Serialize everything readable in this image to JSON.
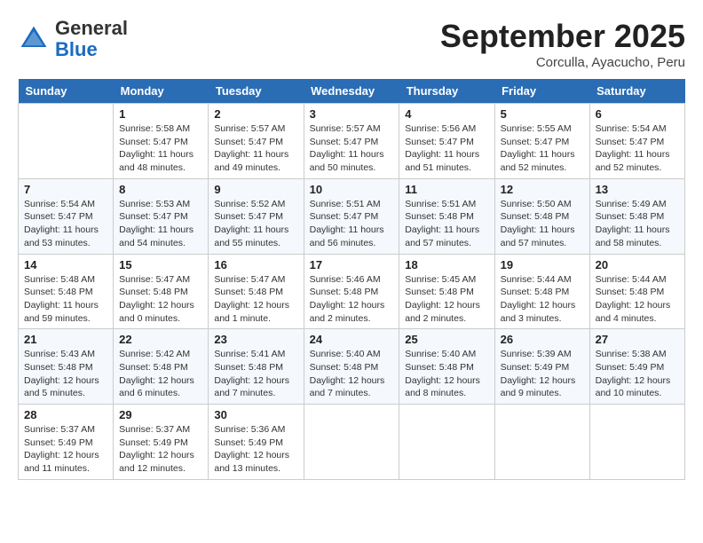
{
  "header": {
    "logo_general": "General",
    "logo_blue": "Blue",
    "month_title": "September 2025",
    "location": "Corculla, Ayacucho, Peru"
  },
  "columns": [
    "Sunday",
    "Monday",
    "Tuesday",
    "Wednesday",
    "Thursday",
    "Friday",
    "Saturday"
  ],
  "weeks": [
    [
      {
        "num": "",
        "info": ""
      },
      {
        "num": "1",
        "info": "Sunrise: 5:58 AM\nSunset: 5:47 PM\nDaylight: 11 hours\nand 48 minutes."
      },
      {
        "num": "2",
        "info": "Sunrise: 5:57 AM\nSunset: 5:47 PM\nDaylight: 11 hours\nand 49 minutes."
      },
      {
        "num": "3",
        "info": "Sunrise: 5:57 AM\nSunset: 5:47 PM\nDaylight: 11 hours\nand 50 minutes."
      },
      {
        "num": "4",
        "info": "Sunrise: 5:56 AM\nSunset: 5:47 PM\nDaylight: 11 hours\nand 51 minutes."
      },
      {
        "num": "5",
        "info": "Sunrise: 5:55 AM\nSunset: 5:47 PM\nDaylight: 11 hours\nand 52 minutes."
      },
      {
        "num": "6",
        "info": "Sunrise: 5:54 AM\nSunset: 5:47 PM\nDaylight: 11 hours\nand 52 minutes."
      }
    ],
    [
      {
        "num": "7",
        "info": "Sunrise: 5:54 AM\nSunset: 5:47 PM\nDaylight: 11 hours\nand 53 minutes."
      },
      {
        "num": "8",
        "info": "Sunrise: 5:53 AM\nSunset: 5:47 PM\nDaylight: 11 hours\nand 54 minutes."
      },
      {
        "num": "9",
        "info": "Sunrise: 5:52 AM\nSunset: 5:47 PM\nDaylight: 11 hours\nand 55 minutes."
      },
      {
        "num": "10",
        "info": "Sunrise: 5:51 AM\nSunset: 5:47 PM\nDaylight: 11 hours\nand 56 minutes."
      },
      {
        "num": "11",
        "info": "Sunrise: 5:51 AM\nSunset: 5:48 PM\nDaylight: 11 hours\nand 57 minutes."
      },
      {
        "num": "12",
        "info": "Sunrise: 5:50 AM\nSunset: 5:48 PM\nDaylight: 11 hours\nand 57 minutes."
      },
      {
        "num": "13",
        "info": "Sunrise: 5:49 AM\nSunset: 5:48 PM\nDaylight: 11 hours\nand 58 minutes."
      }
    ],
    [
      {
        "num": "14",
        "info": "Sunrise: 5:48 AM\nSunset: 5:48 PM\nDaylight: 11 hours\nand 59 minutes."
      },
      {
        "num": "15",
        "info": "Sunrise: 5:47 AM\nSunset: 5:48 PM\nDaylight: 12 hours\nand 0 minutes."
      },
      {
        "num": "16",
        "info": "Sunrise: 5:47 AM\nSunset: 5:48 PM\nDaylight: 12 hours\nand 1 minute."
      },
      {
        "num": "17",
        "info": "Sunrise: 5:46 AM\nSunset: 5:48 PM\nDaylight: 12 hours\nand 2 minutes."
      },
      {
        "num": "18",
        "info": "Sunrise: 5:45 AM\nSunset: 5:48 PM\nDaylight: 12 hours\nand 2 minutes."
      },
      {
        "num": "19",
        "info": "Sunrise: 5:44 AM\nSunset: 5:48 PM\nDaylight: 12 hours\nand 3 minutes."
      },
      {
        "num": "20",
        "info": "Sunrise: 5:44 AM\nSunset: 5:48 PM\nDaylight: 12 hours\nand 4 minutes."
      }
    ],
    [
      {
        "num": "21",
        "info": "Sunrise: 5:43 AM\nSunset: 5:48 PM\nDaylight: 12 hours\nand 5 minutes."
      },
      {
        "num": "22",
        "info": "Sunrise: 5:42 AM\nSunset: 5:48 PM\nDaylight: 12 hours\nand 6 minutes."
      },
      {
        "num": "23",
        "info": "Sunrise: 5:41 AM\nSunset: 5:48 PM\nDaylight: 12 hours\nand 7 minutes."
      },
      {
        "num": "24",
        "info": "Sunrise: 5:40 AM\nSunset: 5:48 PM\nDaylight: 12 hours\nand 7 minutes."
      },
      {
        "num": "25",
        "info": "Sunrise: 5:40 AM\nSunset: 5:48 PM\nDaylight: 12 hours\nand 8 minutes."
      },
      {
        "num": "26",
        "info": "Sunrise: 5:39 AM\nSunset: 5:49 PM\nDaylight: 12 hours\nand 9 minutes."
      },
      {
        "num": "27",
        "info": "Sunrise: 5:38 AM\nSunset: 5:49 PM\nDaylight: 12 hours\nand 10 minutes."
      }
    ],
    [
      {
        "num": "28",
        "info": "Sunrise: 5:37 AM\nSunset: 5:49 PM\nDaylight: 12 hours\nand 11 minutes."
      },
      {
        "num": "29",
        "info": "Sunrise: 5:37 AM\nSunset: 5:49 PM\nDaylight: 12 hours\nand 12 minutes."
      },
      {
        "num": "30",
        "info": "Sunrise: 5:36 AM\nSunset: 5:49 PM\nDaylight: 12 hours\nand 13 minutes."
      },
      {
        "num": "",
        "info": ""
      },
      {
        "num": "",
        "info": ""
      },
      {
        "num": "",
        "info": ""
      },
      {
        "num": "",
        "info": ""
      }
    ]
  ]
}
